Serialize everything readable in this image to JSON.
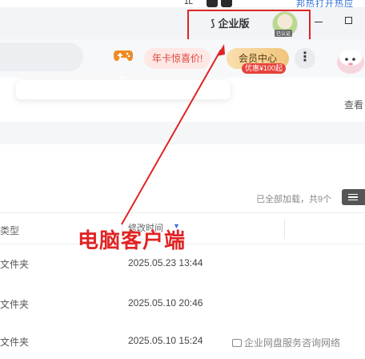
{
  "top_strip": {
    "text1": "1L",
    "text2": "邦热打开热应"
  },
  "title_bar": {
    "enterprise_label": "企业版",
    "avatar_tag": "已认证"
  },
  "toolbar": {
    "promo_label": "年卡惊喜价!",
    "vip_label": "会员中心",
    "vip_badge": "优惠¥100起",
    "more_label": "⋮"
  },
  "content": {
    "view_all": "查看",
    "load_status": "已全部加载，共9个",
    "columns": {
      "type": "类型",
      "time": "修改时间"
    },
    "rows": [
      {
        "type": "文件夹",
        "time": "2025.05.23 13:44"
      },
      {
        "type": "文件夹",
        "time": "2025.05.10 20:46"
      },
      {
        "type": "文件夹",
        "time": "2025.05.10 15:24"
      }
    ]
  },
  "annotation": {
    "label": "电脑客户端",
    "color": "#e02424"
  },
  "watermark": {
    "text": "企业网盘服务咨询网络"
  },
  "colors": {
    "accent_red": "#e02424",
    "vip_gold": "#f1c57d",
    "promo_red": "#e0463b"
  }
}
